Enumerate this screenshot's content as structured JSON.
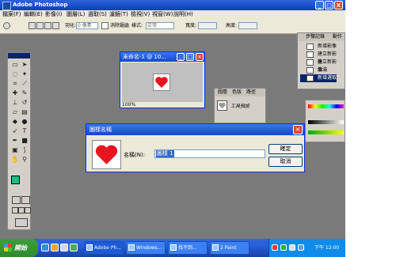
{
  "app": {
    "title": "Adobe Photoshop",
    "title_bar_buttons": [
      "_",
      "□",
      "X"
    ]
  },
  "menu": [
    "檔案(F)",
    "編輯(E)",
    "影像(I)",
    "圖層(L)",
    "選取(S)",
    "濾鏡(T)",
    "檢視(V)",
    "視窗(W)",
    "說明(H)"
  ],
  "options": {
    "feather_label": "羽化:",
    "feather_value": "0 像素",
    "antialias_label": "消除鋸齒",
    "style_label": "樣式:",
    "style_value": "正常",
    "width_label": "寬度:",
    "height_label": "高度:"
  },
  "doc_window": {
    "title": "未命名-1 @ 10...",
    "zoom": "100%"
  },
  "layers_palette": {
    "tabs": [
      "圖層",
      "色版",
      "路徑"
    ],
    "preset_label": "工具預設"
  },
  "history_palette": {
    "tabs": [
      "步驟記錄",
      "動作"
    ],
    "items": [
      "新增影像",
      "建立新影像",
      "建立新影像",
      "填滿",
      "新增選取"
    ]
  },
  "dialog": {
    "title": "圖樣名稱",
    "name_label": "名稱(N):",
    "name_value": "圖樣 1",
    "ok_label": "確定",
    "cancel_label": "取消"
  },
  "taskbar": {
    "start_label": "開始",
    "tasks": [
      "Adobe Ph...",
      "Windows...",
      "找不到...",
      "2 Paint"
    ],
    "clock": "下午 12:00"
  },
  "colors": {
    "accent": "#0a3fc2",
    "heart": "#e8141e",
    "foreground_swatch": "#26b98a",
    "taskbar": "#245edb"
  }
}
